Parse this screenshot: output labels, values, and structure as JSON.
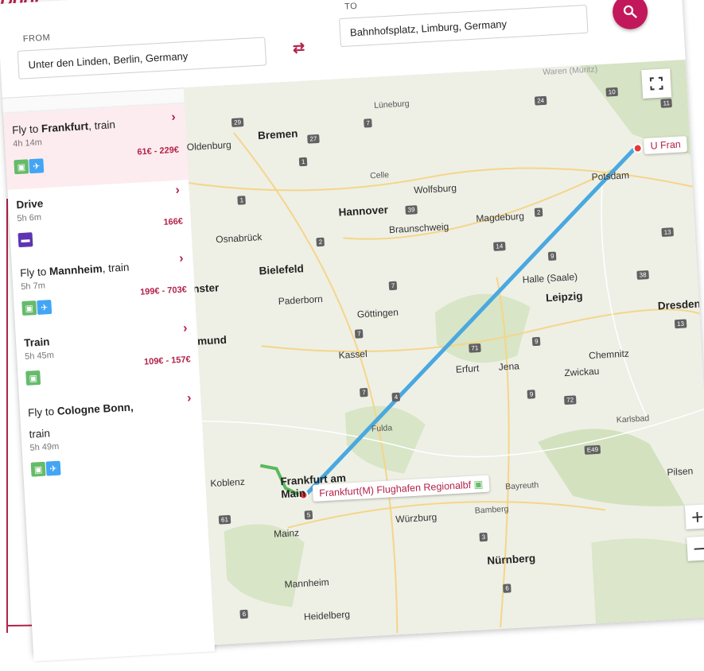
{
  "corner_title": "Door",
  "search": {
    "from_label": "FROM",
    "from_value": "Unter den Linden, Berlin, Germany",
    "to_label": "TO",
    "to_value": "Bahnhofsplatz, Limburg, Germany"
  },
  "routes": [
    {
      "title_prefix": "Fly to ",
      "title_bold": "Frankfurt",
      "title_suffix": ", train",
      "duration": "4h 14m",
      "price": "61€ - 229€",
      "modes": [
        "train",
        "plane"
      ],
      "active": true
    },
    {
      "title_prefix": "",
      "title_bold": "Drive",
      "title_suffix": "",
      "duration": "5h 6m",
      "price": "166€",
      "modes": [
        "car"
      ],
      "active": false
    },
    {
      "title_prefix": "Fly to ",
      "title_bold": "Mannheim",
      "title_suffix": ", train",
      "duration": "5h 7m",
      "price": "199€ - 703€",
      "modes": [
        "train",
        "plane"
      ],
      "active": false
    },
    {
      "title_prefix": "",
      "title_bold": "Train",
      "title_suffix": "",
      "duration": "5h 45m",
      "price": "109€ - 157€",
      "modes": [
        "train"
      ],
      "active": false
    },
    {
      "title_prefix": "Fly to ",
      "title_bold": "Cologne Bonn,",
      "title_suffix": "",
      "title_line2": "train",
      "duration": "5h 49m",
      "price": "",
      "modes": [
        "train",
        "plane"
      ],
      "active": false
    }
  ],
  "map": {
    "cities": [
      {
        "name": "Lüneburg",
        "size": "small"
      },
      {
        "name": "Bremen",
        "size": "big"
      },
      {
        "name": "Oldenburg",
        "size": "normal"
      },
      {
        "name": "Celle",
        "size": "small"
      },
      {
        "name": "Wolfsburg",
        "size": "normal"
      },
      {
        "name": "Hannover",
        "size": "big"
      },
      {
        "name": "Osnabrück",
        "size": "normal"
      },
      {
        "name": "Braunschweig",
        "size": "normal"
      },
      {
        "name": "Magdeburg",
        "size": "normal"
      },
      {
        "name": "Potsdam",
        "size": "normal"
      },
      {
        "name": "Bielefeld",
        "size": "big"
      },
      {
        "name": "Münster",
        "size": "big"
      },
      {
        "name": "Paderborn",
        "size": "normal"
      },
      {
        "name": "Göttingen",
        "size": "normal"
      },
      {
        "name": "Halle (Saale)",
        "size": "normal"
      },
      {
        "name": "Leipzig",
        "size": "big"
      },
      {
        "name": "Dortmund",
        "size": "big"
      },
      {
        "name": "Kassel",
        "size": "normal"
      },
      {
        "name": "Dresden",
        "size": "big"
      },
      {
        "name": "Erfurt",
        "size": "normal"
      },
      {
        "name": "Jena",
        "size": "normal"
      },
      {
        "name": "Chemnitz",
        "size": "normal"
      },
      {
        "name": "Zwickau",
        "size": "normal"
      },
      {
        "name": "Fulda",
        "size": "small"
      },
      {
        "name": "Karlsbad",
        "size": "small"
      },
      {
        "name": "Koblenz",
        "size": "normal"
      },
      {
        "name": "Frankfurt am Main",
        "size": "big"
      },
      {
        "name": "Bayreuth",
        "size": "small"
      },
      {
        "name": "Würzburg",
        "size": "normal"
      },
      {
        "name": "Bamberg",
        "size": "small"
      },
      {
        "name": "Mainz",
        "size": "normal"
      },
      {
        "name": "Pilsen",
        "size": "normal"
      },
      {
        "name": "Nürnberg",
        "size": "big"
      },
      {
        "name": "Mannheim",
        "size": "normal"
      },
      {
        "name": "Heidelberg",
        "size": "normal"
      },
      {
        "name": "Waren (Müritz)",
        "size": "small"
      }
    ],
    "origin_label": "U Fran",
    "dest_label": "Frankfurt(M) Flughafen Regionalbf",
    "highways": [
      "29",
      "7",
      "1",
      "27",
      "1",
      "2",
      "39",
      "2",
      "7",
      "14",
      "9",
      "7",
      "38",
      "71",
      "9",
      "4",
      "7",
      "9",
      "72",
      "5",
      "3",
      "6",
      "61",
      "6",
      "E49",
      "10",
      "24",
      "11",
      "13",
      "13"
    ],
    "colors": {
      "route_line": "#4aa8e0",
      "route_walk": "#5cb85c",
      "accent": "#b3234a"
    }
  }
}
